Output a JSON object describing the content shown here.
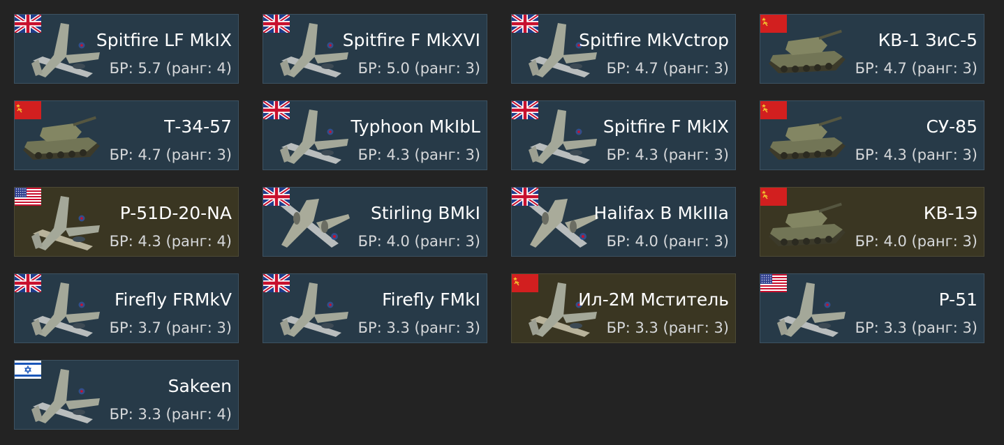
{
  "vehicles": [
    {
      "name": "Spitfire LF MkIX",
      "br": "БР: 5.7 (ранг: 4)",
      "flag": "uk",
      "kind": "plane",
      "premium": false
    },
    {
      "name": "Spitfire F MkXVI",
      "br": "БР: 5.0 (ранг: 3)",
      "flag": "uk",
      "kind": "plane",
      "premium": false
    },
    {
      "name": "Spitfire MkVctrop",
      "br": "БР: 4.7 (ранг: 3)",
      "flag": "uk",
      "kind": "plane",
      "premium": false
    },
    {
      "name": "КВ-1 ЗиС-5",
      "br": "БР: 4.7 (ранг: 3)",
      "flag": "ussr",
      "kind": "tank",
      "premium": false
    },
    {
      "name": "Т-34-57",
      "br": "БР: 4.7 (ранг: 3)",
      "flag": "ussr",
      "kind": "tank",
      "premium": false
    },
    {
      "name": "Typhoon MkIbL",
      "br": "БР: 4.3 (ранг: 3)",
      "flag": "uk",
      "kind": "plane",
      "premium": false
    },
    {
      "name": "Spitfire F MkIX",
      "br": "БР: 4.3 (ранг: 3)",
      "flag": "uk",
      "kind": "plane",
      "premium": false
    },
    {
      "name": "СУ-85",
      "br": "БР: 4.3 (ранг: 3)",
      "flag": "ussr",
      "kind": "tank",
      "premium": false
    },
    {
      "name": "P-51D-20-NA",
      "br": "БР: 4.3 (ранг: 4)",
      "flag": "usa",
      "kind": "plane",
      "premium": true
    },
    {
      "name": "Stirling BMkI",
      "br": "БР: 4.0 (ранг: 3)",
      "flag": "uk",
      "kind": "bomber",
      "premium": false
    },
    {
      "name": "Halifax B MkIIIa",
      "br": "БР: 4.0 (ранг: 3)",
      "flag": "uk",
      "kind": "bomber",
      "premium": false
    },
    {
      "name": "КВ-1Э",
      "br": "БР: 4.0 (ранг: 3)",
      "flag": "ussr",
      "kind": "tank",
      "premium": true
    },
    {
      "name": "Firefly FRMkV",
      "br": "БР: 3.7 (ранг: 3)",
      "flag": "uk",
      "kind": "plane",
      "premium": false
    },
    {
      "name": "Firefly FMkI",
      "br": "БР: 3.3 (ранг: 3)",
      "flag": "uk",
      "kind": "plane",
      "premium": false
    },
    {
      "name": "Ил-2М Мститель",
      "br": "БР: 3.3 (ранг: 3)",
      "flag": "ussr",
      "kind": "plane",
      "premium": true
    },
    {
      "name": "P-51",
      "br": "БР: 3.3 (ранг: 3)",
      "flag": "usa",
      "kind": "plane",
      "premium": false
    },
    {
      "name": "Sakeen",
      "br": "БР: 3.3 (ранг: 4)",
      "flag": "israel",
      "kind": "plane",
      "premium": false
    }
  ],
  "colors": {
    "background": "#232323",
    "card": "#273a48",
    "card_premium": "#3a3622",
    "card_border": "#3d5262",
    "br_text": "#d6d8da"
  }
}
